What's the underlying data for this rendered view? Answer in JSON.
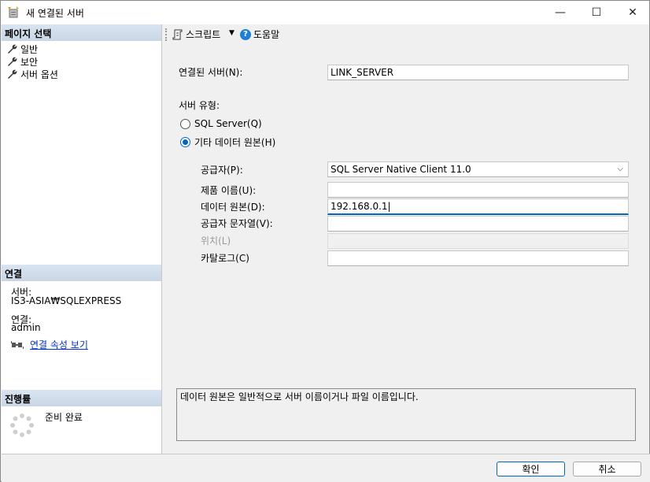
{
  "window": {
    "title": "새 연결된 서버",
    "min_glyph": "—",
    "max_glyph": "☐",
    "close_glyph": "✕"
  },
  "left": {
    "page_select_header": "페이지 선택",
    "nav_items": [
      "일반",
      "보안",
      "서버 옵션"
    ],
    "connection_header": "연결",
    "server_label": "서버:",
    "server_value": "IS3-ASIA₩SQLEXPRESS",
    "connection_label": "연결:",
    "connection_value": "admin",
    "view_properties_link": "연결 속성 보기",
    "progress_header": "진행률",
    "progress_status": "준비 완료"
  },
  "toolbar": {
    "script_label": "스크립트",
    "help_label": "도움말"
  },
  "form": {
    "linked_server_label": "연결된 서버(N):",
    "linked_server_value": "LINK_SERVER",
    "server_type_label": "서버 유형:",
    "radio_sql_server": "SQL Server(Q)",
    "radio_other": "기타 데이터 원본(H)",
    "provider_label": "공급자(P):",
    "provider_value": "SQL Server Native Client 11.0",
    "product_name_label": "제품 이름(U):",
    "product_name_value": "",
    "data_source_label": "데이터 원본(D):",
    "data_source_value": "192.168.0.1|",
    "provider_string_label": "공급자 문자열(V):",
    "provider_string_value": "",
    "location_label": "위치(L)",
    "location_value": "",
    "catalog_label": "카탈로그(C)",
    "catalog_value": "",
    "description": "데이터 원본은 일반적으로 서버 이름이거나 파일 이름입니다."
  },
  "buttons": {
    "ok": "확인",
    "cancel": "취소"
  },
  "colors": {
    "accent": "#0067c0",
    "link": "#0033cc",
    "header_bg": "#d9e4f1"
  }
}
